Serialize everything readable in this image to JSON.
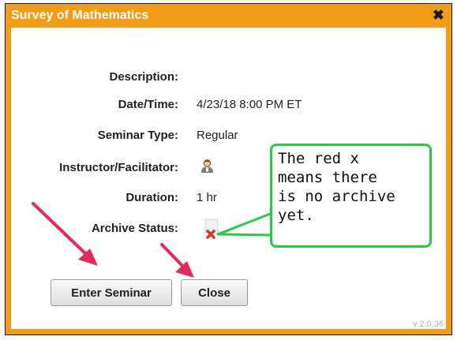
{
  "dialog": {
    "title": "Survey of Mathematics",
    "close_glyph": "✖"
  },
  "fields": {
    "description_label": "Description:",
    "description_value": "",
    "datetime_label": "Date/Time:",
    "datetime_value": "4/23/18 8:00 PM ET",
    "seminar_type_label": "Seminar Type:",
    "seminar_type_value": "Regular",
    "instructor_label": "Instructor/Facilitator:",
    "instructor_icon": "person-icon",
    "duration_label": "Duration:",
    "duration_value": "1 hr",
    "archive_label": "Archive Status:",
    "archive_icon": "red-x-icon"
  },
  "buttons": {
    "enter_label": "Enter Seminar",
    "close_label": "Close"
  },
  "version": "v 2.0.36",
  "annotation": {
    "callout_lines": [
      "The red x",
      "means there",
      "is no archive",
      "yet."
    ],
    "callout_border_color": "#24cc44",
    "arrow_color": "#e8285a"
  },
  "colors": {
    "title_bar": "#f39c16",
    "title_text": "#ffffff"
  }
}
